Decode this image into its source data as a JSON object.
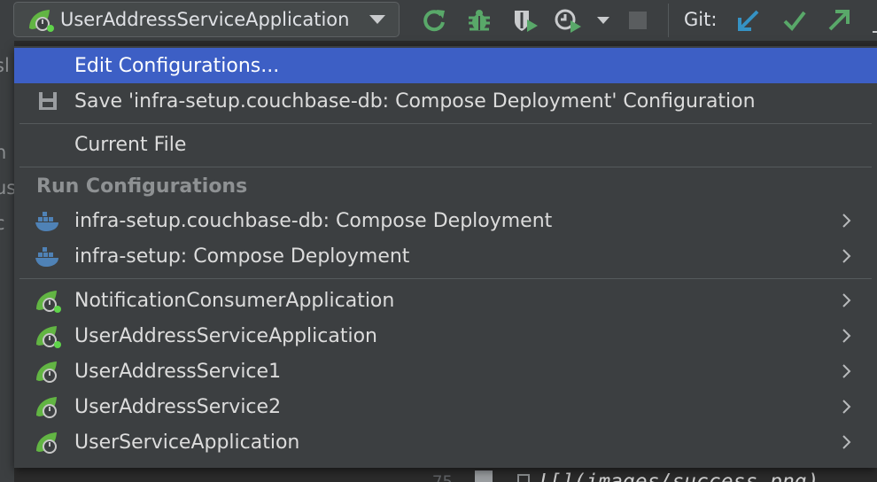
{
  "toolbar": {
    "run_config_selected": "UserAddressServiceApplication",
    "git_label": "Git:",
    "icons": [
      "spring-boot-icon",
      "rerun-icon",
      "debug-icon",
      "coverage-icon",
      "profile-icon",
      "stop-icon",
      "git-update-icon",
      "git-commit-icon",
      "git-push-icon"
    ]
  },
  "background": {
    "left_strip_fragments": [
      "sl",
      "n",
      "us",
      "c"
    ],
    "editor_line_number": "75",
    "editor_code": "![](images/success.png)"
  },
  "menu": {
    "edit_configurations": "Edit Configurations...",
    "save_configuration": "Save 'infra-setup.couchbase-db: Compose Deployment' Configuration",
    "current_file": "Current File",
    "section_header": "Run Configurations",
    "run_configurations": [
      {
        "label": "infra-setup.couchbase-db: Compose Deployment",
        "icon": "docker-icon"
      },
      {
        "label": "infra-setup: Compose Deployment",
        "icon": "docker-icon"
      },
      {
        "label": "NotificationConsumerApplication",
        "icon": "spring-boot-running-icon"
      },
      {
        "label": "UserAddressServiceApplication",
        "icon": "spring-boot-running-icon"
      },
      {
        "label": "UserAddressService1",
        "icon": "spring-boot-icon"
      },
      {
        "label": "UserAddressService2",
        "icon": "spring-boot-icon"
      },
      {
        "label": "UserServiceApplication",
        "icon": "spring-boot-icon"
      }
    ]
  },
  "colors": {
    "selection": "#3d5fc5",
    "popup_background": "#3c3f41",
    "spring_green": "#62b543",
    "docker_blue": "#4f82b6",
    "git_blue": "#3592c4",
    "git_green": "#59a869"
  }
}
